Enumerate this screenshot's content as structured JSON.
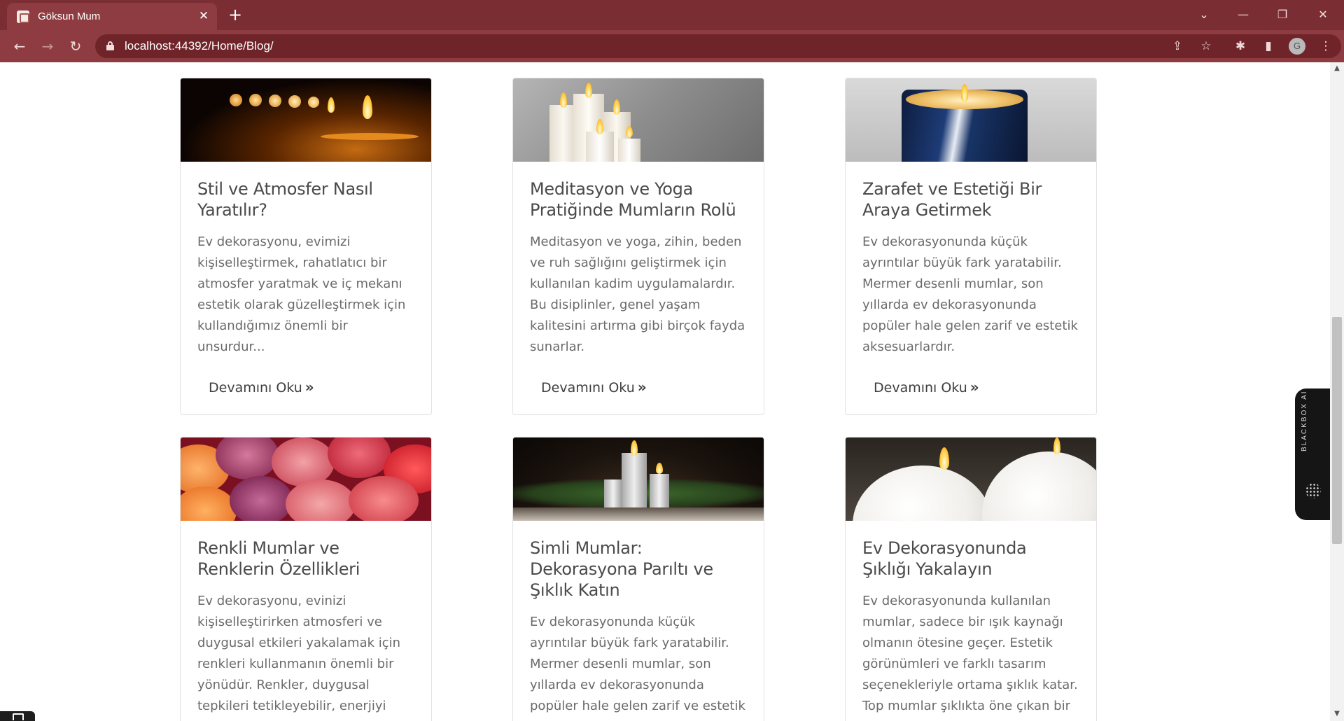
{
  "browser": {
    "tab_title": "Göksun Mum",
    "url": "localhost:44392/Home/Blog/",
    "profile_initial": "G"
  },
  "widget": {
    "label": "BLACKBOX AI"
  },
  "posts": [
    {
      "title": "Stil ve Atmosfer Nasıl Yaratılır?",
      "excerpt": "Ev dekorasyonu, evimizi kişiselleştirmek, rahatlatıcı bir atmosfer yaratmak ve iç mekanı estetik olarak güzelleştirmek için kullandığımız önemli bir unsurdur...",
      "read_more": "Devamını Oku",
      "image": "row-of-candles-dark"
    },
    {
      "title": "Meditasyon ve Yoga Pratiğinde Mumların Rolü",
      "excerpt": "Meditasyon ve yoga, zihin, beden ve ruh sağlığını geliştirmek için kullanılan kadim uygulamalardır. Bu disiplinler, genel yaşam kalitesini artırma gibi birçok fayda sunarlar.",
      "read_more": "Devamını Oku",
      "image": "white-pillar-candles"
    },
    {
      "title": "Zarafet ve Estetiği Bir Araya Getirmek",
      "excerpt": "Ev dekorasyonunda küçük ayrıntılar büyük fark yaratabilir. Mermer desenli mumlar, son yıllarda ev dekorasyonunda popüler hale gelen zarif ve estetik aksesuarlardır.",
      "read_more": "Devamını Oku",
      "image": "marble-blue-candle"
    },
    {
      "title": "Renkli Mumlar ve Renklerin Özellikleri",
      "excerpt": "Ev dekorasyonu, evinizi kişiselleştirirken atmosferi ve duygusal etkileri yakalamak için renkleri kullanmanın önemli bir yönüdür. Renkler, duygusal tepkileri tetikleyebilir, enerjiyi",
      "image": "colorful-candles"
    },
    {
      "title": "Simli Mumlar: Dekorasyona Parıltı ve Şıklık Katın",
      "excerpt": "Ev dekorasyonunda küçük ayrıntılar büyük fark yaratabilir. Mermer desenli mumlar, son yıllarda ev dekorasyonunda popüler hale gelen zarif ve estetik",
      "image": "silver-glitter-candles"
    },
    {
      "title": "Ev Dekorasyonunda Şıklığı Yakalayın",
      "excerpt": "Ev dekorasyonunda kullanılan mumlar, sadece bir ışık kaynağı olmanın ötesine geçer. Estetik görünümleri ve farklı tasarım seçenekleriyle ortama şıklık katar. Top mumlar şıklıkta öne çıkan bir",
      "image": "white-ball-candles"
    }
  ]
}
